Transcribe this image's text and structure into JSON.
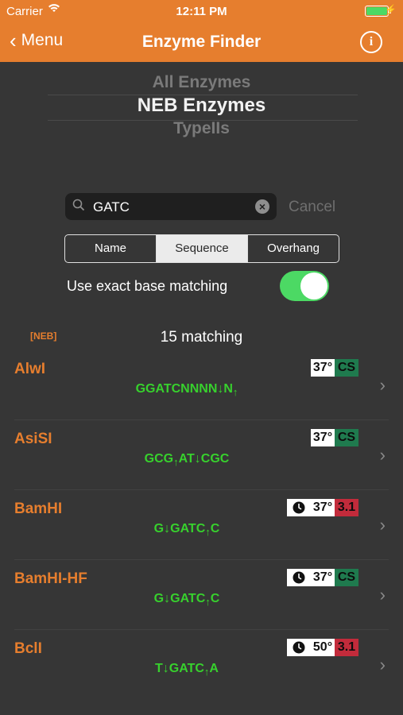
{
  "status_bar": {
    "carrier": "Carrier",
    "time": "12:11 PM"
  },
  "nav": {
    "back_label": "Menu",
    "title": "Enzyme Finder"
  },
  "picker": {
    "options": [
      "All Enzymes",
      "NEB Enzymes",
      "TypeIIs"
    ],
    "selected": "NEB Enzymes"
  },
  "search": {
    "value": "GATC",
    "cancel_label": "Cancel"
  },
  "segments": {
    "items": [
      "Name",
      "Sequence",
      "Overhang"
    ],
    "selected": "Sequence"
  },
  "exact_match": {
    "label": "Use exact base matching",
    "on": true
  },
  "results": {
    "source_tag": "[NEB]",
    "count_label": "15 matching"
  },
  "enzymes": [
    {
      "name": "AlwI",
      "temp": "37°",
      "buffer": "CS",
      "time_saver": false,
      "seq_parts": [
        "GGATCNNNN↓N",
        "↑"
      ]
    },
    {
      "name": "AsiSI",
      "temp": "37°",
      "buffer": "CS",
      "time_saver": false,
      "seq_parts": [
        "GCG",
        "↑",
        "AT↓CGC"
      ]
    },
    {
      "name": "BamHI",
      "temp": "37°",
      "buffer": "3.1",
      "time_saver": true,
      "seq_parts": [
        "G↓GATC",
        "↑",
        "C"
      ]
    },
    {
      "name": "BamHI-HF",
      "temp": "37°",
      "buffer": "CS",
      "time_saver": true,
      "seq_parts": [
        "G↓GATC",
        "↑",
        "C"
      ]
    },
    {
      "name": "BclI",
      "temp": "50°",
      "buffer": "3.1",
      "time_saver": true,
      "seq_parts": [
        "T↓GATC",
        "↑",
        "A"
      ]
    }
  ],
  "colors": {
    "accent": "#e67e2e",
    "sequence": "#37d12d",
    "buffer_cs": "#1f7a4e",
    "buffer_31": "#c22b3b",
    "toggle_on": "#4cd964"
  }
}
